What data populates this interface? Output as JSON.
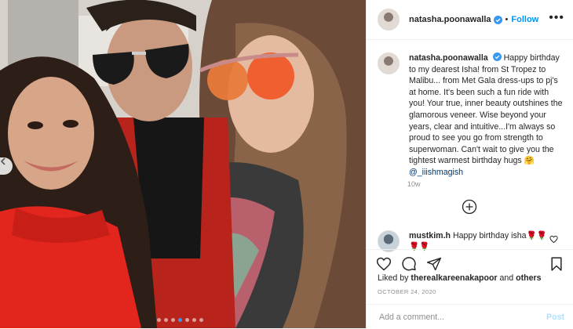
{
  "post": {
    "username": "natasha.poonawalla",
    "separator": "•",
    "follow_label": "Follow",
    "more_label": "•••"
  },
  "caption": {
    "username": "natasha.poonawalla",
    "text": "Happy birthday to my dearest Isha! from St Tropez to Malibu... from Met Gala dress-ups to pj's at home. It's been such a fun ride with you! Your true, inner beauty outshines the glamorous veneer. Wise beyond your years, clear and intuitive...I'm always so proud to see you go from strength to superwoman. Can't wait to give you the tightest warmest birthday hugs 🤗",
    "mention": "@_iiishmagish",
    "time": "10w"
  },
  "comment": {
    "username": "mustkim.h",
    "text": "Happy birthday isha🌹🌹🌹🌹"
  },
  "likes": {
    "prefix": "Liked by",
    "user": "therealkareenakapoor",
    "and": "and",
    "others": "others"
  },
  "date": "OCTOBER 24, 2020",
  "add_comment": {
    "placeholder": "Add a comment...",
    "post_label": "Post"
  },
  "carousel": {
    "slide_count": 7,
    "active_index": 3
  },
  "colors": {
    "accent": "#0095f6",
    "verified": "#3897f0",
    "link": "#00376b"
  }
}
